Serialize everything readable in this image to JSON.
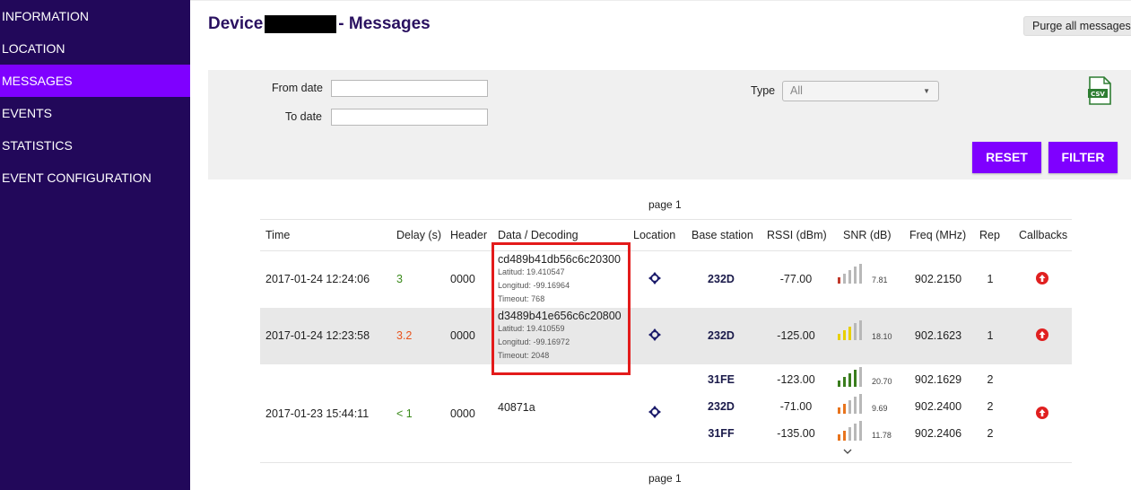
{
  "sidebar": {
    "items": [
      {
        "label": "INFORMATION",
        "active": false
      },
      {
        "label": "LOCATION",
        "active": false
      },
      {
        "label": "MESSAGES",
        "active": true
      },
      {
        "label": "EVENTS",
        "active": false
      },
      {
        "label": "STATISTICS",
        "active": false
      },
      {
        "label": "EVENT CONFIGURATION",
        "active": false
      }
    ],
    "colors": {
      "background": "#22085a",
      "active": "#7f00ff"
    }
  },
  "header": {
    "title_prefix": "Device",
    "title_suffix": "- Messages",
    "purge_label": "Purge all messages"
  },
  "filter": {
    "from_label": "From date",
    "from_value": "",
    "to_label": "To date",
    "to_value": "",
    "type_label": "Type",
    "type_value": "All",
    "csv_icon": "csv-file-icon",
    "csv_text": "CSV",
    "reset_label": "RESET",
    "filter_label": "FILTER"
  },
  "pager": {
    "top": "page 1",
    "bottom": "page 1"
  },
  "table": {
    "headers": [
      "Time",
      "Delay (s)",
      "Header",
      "Data / Decoding",
      "Location",
      "Base station",
      "RSSI (dBm)",
      "SNR (dB)",
      "Freq (MHz)",
      "Rep",
      "Callbacks"
    ],
    "rows": [
      {
        "time": "2017-01-24 12:24:06",
        "delay": "3",
        "delay_color": "#3a8a1a",
        "header": "0000",
        "data": "cd489b41db56c6c20300",
        "decoding": [
          "Latitud: 19.410547",
          "Longitud: -99.16964",
          "Timeout: 768"
        ],
        "stations": [
          {
            "station": "232D",
            "rssi": "-77.00",
            "snr": "7.81",
            "snr_bars": 1,
            "bar_color": "#c0392b",
            "freq": "902.2150",
            "rep": "1"
          }
        ]
      },
      {
        "time": "2017-01-24 12:23:58",
        "delay": "3.2",
        "delay_color": "#e8541e",
        "header": "0000",
        "data": "d3489b41e656c6c20800",
        "decoding": [
          "Latitud: 19.410559",
          "Longitud: -99.16972",
          "Timeout: 2048"
        ],
        "stations": [
          {
            "station": "232D",
            "rssi": "-125.00",
            "snr": "18.10",
            "snr_bars": 3,
            "bar_color": "#e8d000",
            "freq": "902.1623",
            "rep": "1"
          }
        ]
      },
      {
        "time": "2017-01-23 15:44:11",
        "delay": "< 1",
        "delay_color": "#3a8a1a",
        "header": "0000",
        "data": "40871a",
        "decoding": [],
        "stations": [
          {
            "station": "31FE",
            "rssi": "-123.00",
            "snr": "20.70",
            "snr_bars": 4,
            "bar_color": "#3a7d1e",
            "freq": "902.1629",
            "rep": "2"
          },
          {
            "station": "232D",
            "rssi": "-71.00",
            "snr": "9.69",
            "snr_bars": 2,
            "bar_color": "#e8741e",
            "freq": "902.2400",
            "rep": "2"
          },
          {
            "station": "31FF",
            "rssi": "-135.00",
            "snr": "11.78",
            "snr_bars": 2,
            "bar_color": "#e8741e",
            "freq": "902.2406",
            "rep": "2"
          }
        ]
      }
    ]
  },
  "icons": {
    "location": "crosshair-icon",
    "callback": "arrow-up-circle-icon",
    "expand": "chevron-down-icon"
  }
}
